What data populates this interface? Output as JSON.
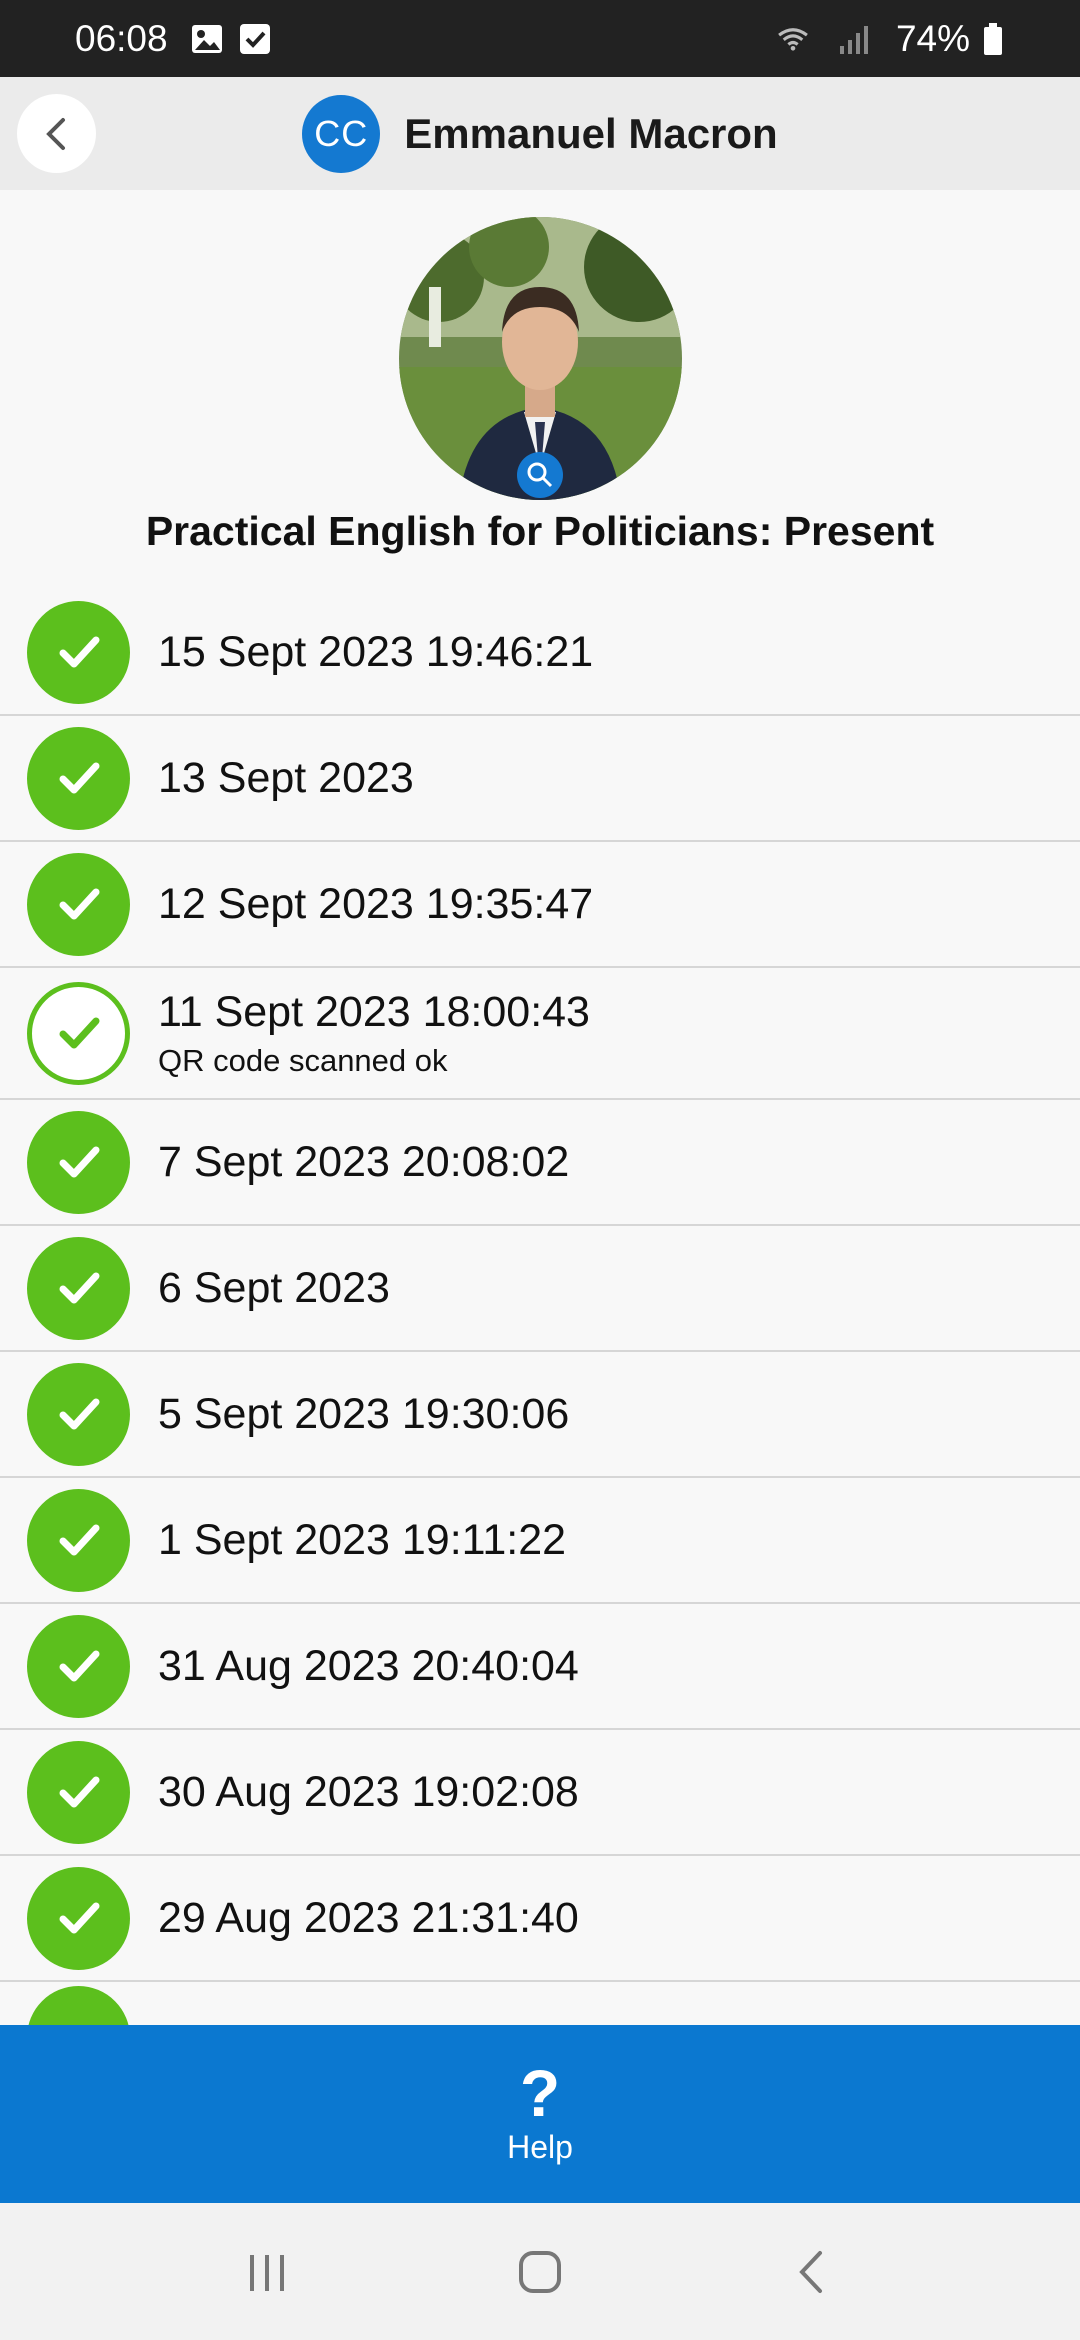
{
  "status_bar": {
    "time": "06:08",
    "battery": "74%"
  },
  "header": {
    "avatar_initials": "CC",
    "title": "Emmanuel Macron"
  },
  "profile": {
    "course_title": "Practical English for Politicians: Present"
  },
  "attendance": [
    {
      "date": "15 Sept 2023 19:46:21",
      "note": "",
      "style": "filled"
    },
    {
      "date": "13 Sept 2023",
      "note": "",
      "style": "filled"
    },
    {
      "date": "12 Sept 2023 19:35:47",
      "note": "",
      "style": "filled"
    },
    {
      "date": "11 Sept 2023 18:00:43",
      "note": "QR code scanned ok",
      "style": "outline"
    },
    {
      "date": "7 Sept 2023 20:08:02",
      "note": "",
      "style": "filled"
    },
    {
      "date": "6 Sept 2023",
      "note": "",
      "style": "filled"
    },
    {
      "date": "5 Sept 2023 19:30:06",
      "note": "",
      "style": "filled"
    },
    {
      "date": "1 Sept 2023 19:11:22",
      "note": "",
      "style": "filled"
    },
    {
      "date": "31 Aug 2023 20:40:04",
      "note": "",
      "style": "filled"
    },
    {
      "date": "30 Aug 2023 19:02:08",
      "note": "",
      "style": "filled"
    },
    {
      "date": "29 Aug 2023 21:31:40",
      "note": "",
      "style": "filled"
    }
  ],
  "help_bar": {
    "icon": "?",
    "label": "Help"
  },
  "colors": {
    "accent_blue": "#0b78d0",
    "check_green": "#5cbf1d",
    "status_bar": "#222222"
  },
  "icons": [
    "back-chevron-icon",
    "gallery-icon",
    "checkbox-icon",
    "wifi-icon",
    "signal-icon",
    "battery-icon",
    "zoom-icon",
    "checkmark-icon",
    "help-icon",
    "recents-icon",
    "home-icon",
    "back-icon"
  ]
}
